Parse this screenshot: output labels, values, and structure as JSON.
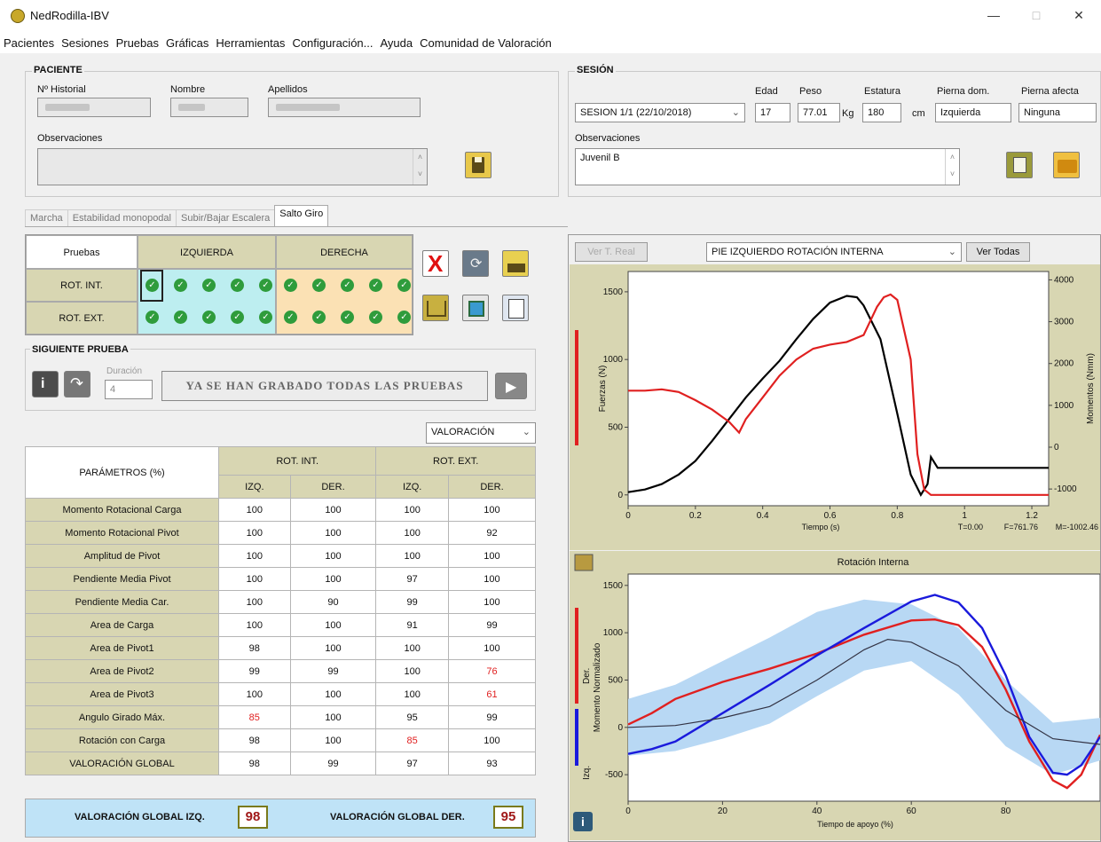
{
  "window": {
    "title": "NedRodilla-IBV",
    "min": "—",
    "max": "□",
    "close": "✕"
  },
  "menu": [
    "Pacientes",
    "Sesiones",
    "Pruebas",
    "Gráficas",
    "Herramientas",
    "Configuración...",
    "Ayuda",
    "Comunidad de Valoración"
  ],
  "patient": {
    "group_title": "PACIENTE",
    "historial_label": "Nº Historial",
    "nombre_label": "Nombre",
    "apellidos_label": "Apellidos",
    "observaciones_label": "Observaciones"
  },
  "session": {
    "group_title": "SESIÓN",
    "session_value": "SESION 1/1 (22/10/2018)",
    "edad_label": "Edad",
    "edad": "17",
    "peso_label": "Peso",
    "peso": "77.01",
    "peso_unit": "Kg",
    "estatura_label": "Estatura",
    "estatura": "180",
    "estatura_unit": "cm",
    "pierna_dom_label": "Pierna dom.",
    "pierna_dom": "Izquierda",
    "pierna_afecta_label": "Pierna afecta",
    "pierna_afecta": "Ninguna",
    "observaciones_label": "Observaciones",
    "observaciones": "Juvenil B"
  },
  "tabs": [
    "Marcha",
    "Estabilidad monopodal",
    "Subir/Bajar Escalera",
    "Salto Giro"
  ],
  "tests": {
    "header_pruebas": "Pruebas",
    "header_izq": "IZQUIERDA",
    "header_der": "DERECHA",
    "rows": [
      "ROT. INT.",
      "ROT. EXT."
    ]
  },
  "next_test": {
    "group_title": "SIGUIENTE PRUEBA",
    "duracion_label": "Duración",
    "duracion": "4",
    "message": "YA SE HAN GRABADO TODAS LAS PRUEBAS"
  },
  "valoracion_select": "VALORACIÓN",
  "params_table": {
    "title": "PARÁMETROS (%)",
    "groups": [
      "ROT. INT.",
      "ROT. EXT."
    ],
    "subcols": [
      "IZQ.",
      "DER.",
      "IZQ.",
      "DER."
    ],
    "rows": [
      {
        "name": "Momento Rotacional Carga",
        "v": [
          "100",
          "100",
          "100",
          "100"
        ]
      },
      {
        "name": "Momento Rotacional Pivot",
        "v": [
          "100",
          "100",
          "100",
          "92"
        ]
      },
      {
        "name": "Amplitud de Pivot",
        "v": [
          "100",
          "100",
          "100",
          "100"
        ]
      },
      {
        "name": "Pendiente Media Pivot",
        "v": [
          "100",
          "100",
          "97",
          "100"
        ]
      },
      {
        "name": "Pendiente Media Car.",
        "v": [
          "100",
          "90",
          "99",
          "100"
        ]
      },
      {
        "name": "Area de Carga",
        "v": [
          "100",
          "100",
          "91",
          "99"
        ]
      },
      {
        "name": "Area de Pivot1",
        "v": [
          "98",
          "100",
          "100",
          "100"
        ]
      },
      {
        "name": "Area de Pivot2",
        "v": [
          "99",
          "99",
          "100",
          "76"
        ]
      },
      {
        "name": "Area de Pivot3",
        "v": [
          "100",
          "100",
          "100",
          "61"
        ]
      },
      {
        "name": "Angulo Girado Máx.",
        "v": [
          "85",
          "100",
          "95",
          "99"
        ]
      },
      {
        "name": "Rotación con Carga",
        "v": [
          "98",
          "100",
          "85",
          "100"
        ]
      },
      {
        "name": "VALORACIÓN GLOBAL",
        "v": [
          "98",
          "99",
          "97",
          "93"
        ]
      }
    ],
    "red_cells": [
      [
        7,
        3
      ],
      [
        8,
        3
      ],
      [
        9,
        0
      ],
      [
        10,
        2
      ]
    ]
  },
  "summary": {
    "izq_label": "VALORACIÓN GLOBAL IZQ.",
    "izq": "98",
    "der_label": "VALORACIÓN GLOBAL DER.",
    "der": "95"
  },
  "chart_controls": {
    "ver_t_real": "Ver T. Real",
    "select": "PIE IZQUIERDO ROTACIÓN INTERNA",
    "ver_todas": "Ver Todas"
  },
  "chart_data": [
    {
      "type": "line",
      "xlabel": "Tiempo (s)",
      "ylabel": "Fuerzas (N)",
      "y2label": "Momentos (Nmm)",
      "xlim": [
        0,
        1.25
      ],
      "ylim": [
        -80,
        1650
      ],
      "y2lim": [
        -1400,
        4200
      ],
      "xticks": [
        "0",
        "0.2",
        "0.4",
        "0.6",
        "0.8",
        "1",
        "1.2"
      ],
      "yticks": [
        "0",
        "500",
        "1000",
        "1500"
      ],
      "y2ticks": [
        "-1000",
        "0",
        "1000",
        "2000",
        "3000",
        "4000"
      ],
      "readout": {
        "t": "T=0.00",
        "f": "F=761.76",
        "m": "M=-1002.46"
      },
      "series": [
        {
          "color": "#000000",
          "axis": "y",
          "x": [
            0,
            0.05,
            0.1,
            0.15,
            0.2,
            0.25,
            0.3,
            0.35,
            0.4,
            0.45,
            0.5,
            0.55,
            0.6,
            0.65,
            0.68,
            0.7,
            0.75,
            0.8,
            0.84,
            0.87,
            0.89,
            0.9,
            0.92,
            1.25
          ],
          "y": [
            20,
            40,
            80,
            150,
            250,
            400,
            560,
            720,
            860,
            990,
            1150,
            1300,
            1420,
            1470,
            1460,
            1400,
            1150,
            600,
            150,
            0,
            80,
            280,
            200,
            200
          ]
        },
        {
          "color": "#e02020",
          "axis": "y",
          "x": [
            0,
            0.05,
            0.1,
            0.15,
            0.2,
            0.25,
            0.3,
            0.33,
            0.35,
            0.4,
            0.45,
            0.5,
            0.55,
            0.6,
            0.65,
            0.7,
            0.74,
            0.76,
            0.78,
            0.8,
            0.84,
            0.86,
            0.88,
            0.9,
            1.25
          ],
          "y": [
            770,
            770,
            780,
            760,
            700,
            630,
            540,
            460,
            560,
            720,
            880,
            1000,
            1080,
            1110,
            1130,
            1180,
            1390,
            1460,
            1480,
            1440,
            1000,
            300,
            40,
            0,
            0
          ]
        }
      ]
    },
    {
      "type": "line",
      "title": "Rotación Interna",
      "xlabel": "Tiempo de apoyo (%)",
      "ylabel": "Momento Normalizado",
      "ylabel_sub": [
        "Izq.",
        "Der."
      ],
      "xlim": [
        0,
        100
      ],
      "ylim": [
        -780,
        1620
      ],
      "xticks": [
        "0",
        "20",
        "40",
        "60",
        "80"
      ],
      "yticks": [
        "-500",
        "0",
        "500",
        "1000",
        "1500"
      ],
      "band": {
        "color": "#b8d8f4",
        "x": [
          0,
          10,
          20,
          30,
          40,
          50,
          60,
          70,
          80,
          90,
          100
        ],
        "upper": [
          300,
          450,
          700,
          950,
          1220,
          1350,
          1300,
          1050,
          500,
          50,
          100
        ],
        "lower": [
          -300,
          -250,
          -120,
          40,
          330,
          600,
          700,
          350,
          -200,
          -500,
          -350
        ]
      },
      "series": [
        {
          "name": "Der.",
          "color": "#e02020",
          "x": [
            0,
            5,
            10,
            20,
            30,
            40,
            50,
            60,
            65,
            70,
            75,
            80,
            85,
            90,
            93,
            96,
            100
          ],
          "y": [
            30,
            150,
            300,
            480,
            620,
            780,
            980,
            1130,
            1140,
            1080,
            850,
            400,
            -150,
            -560,
            -640,
            -500,
            -80
          ]
        },
        {
          "name": "Izq.",
          "color": "#1a1adc",
          "x": [
            0,
            5,
            10,
            20,
            30,
            40,
            50,
            60,
            65,
            70,
            75,
            80,
            85,
            90,
            93,
            96,
            100
          ],
          "y": [
            -280,
            -230,
            -150,
            150,
            450,
            760,
            1050,
            1330,
            1400,
            1320,
            1050,
            550,
            -100,
            -480,
            -500,
            -400,
            -100
          ]
        },
        {
          "name": "Media",
          "color": "#333344",
          "x": [
            0,
            10,
            20,
            30,
            40,
            50,
            55,
            60,
            70,
            80,
            90,
            100
          ],
          "y": [
            0,
            20,
            100,
            220,
            500,
            820,
            930,
            900,
            650,
            180,
            -120,
            -180
          ]
        }
      ]
    }
  ]
}
